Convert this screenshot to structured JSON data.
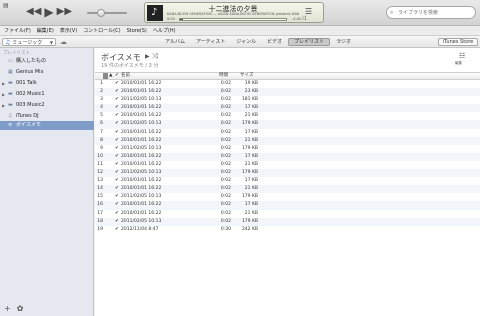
{
  "player": {
    "menu_icon": "▤",
    "rewind": "◀◀",
    "play": "▶",
    "forward": "▶▶",
    "volume_level": 0.3,
    "art_icon": "♪",
    "now_playing_title": "十二進法の夕景",
    "now_playing_sub": "KANA-BOON GENERATION — ASIAN KANA-BOON GENERATION presents NANO-MUGEN",
    "elapsed": "0:00",
    "remaining": "-4:40",
    "progress": 0.03,
    "shuffle_icon": "⤨",
    "list_icon": "☰"
  },
  "search": {
    "placeholder": "ライブラリを検索",
    "icon": "⌕"
  },
  "menubar": [
    "ファイル(F)",
    "編集(E)",
    "表示(V)",
    "コントロール(C)",
    "Store(S)",
    "ヘルプ(H)"
  ],
  "navbar": {
    "library_label": "ミュージック",
    "tabs": [
      "アルバム",
      "アーティスト",
      "ジャンル",
      "ビデオ",
      "プレイリスト",
      "ラジオ"
    ],
    "active_tab": "プレイリスト",
    "store_label": "iTunes Store"
  },
  "sidebar": {
    "header": "プレイリスト",
    "items": [
      {
        "label": "購入したもの",
        "icon": "▭"
      },
      {
        "label": "Genius Mix",
        "icon": "▦"
      },
      {
        "label": "001 Talk",
        "icon": "▬"
      },
      {
        "label": "002 Music1",
        "icon": "▬"
      },
      {
        "label": "003 Music2",
        "icon": "▬"
      },
      {
        "label": "iTunes DJ",
        "icon": "♫"
      },
      {
        "label": "ボイスメモ",
        "icon": "≡"
      }
    ],
    "add_icon": "+",
    "settings_icon": "✿"
  },
  "playlist": {
    "title": "ボイスメモ",
    "meta": "19 件のボイスメモ / 3 分",
    "edit_label": "編集",
    "columns": {
      "name": "名前",
      "time": "時間",
      "size": "サイズ"
    },
    "rows": [
      {
        "n": "1",
        "name": "2010/01/01 16:22",
        "time": "0:02",
        "size": "19 KB"
      },
      {
        "n": "2",
        "name": "2010/01/01 16:22",
        "time": "0:02",
        "size": "23 KB"
      },
      {
        "n": "3",
        "name": "2011/02/05 10:13",
        "time": "0:02",
        "size": "181 KB"
      },
      {
        "n": "4",
        "name": "2010/01/01 16:22",
        "time": "0:02",
        "size": "17 KB"
      },
      {
        "n": "5",
        "name": "2010/01/01 16:22",
        "time": "0:02",
        "size": "21 KB"
      },
      {
        "n": "6",
        "name": "2011/02/05 10:13",
        "time": "0:02",
        "size": "179 KB"
      },
      {
        "n": "7",
        "name": "2010/01/01 16:22",
        "time": "0:02",
        "size": "17 KB"
      },
      {
        "n": "8",
        "name": "2010/01/01 16:22",
        "time": "0:02",
        "size": "21 KB"
      },
      {
        "n": "9",
        "name": "2011/02/05 10:13",
        "time": "0:02",
        "size": "179 KB"
      },
      {
        "n": "10",
        "name": "2010/01/01 16:22",
        "time": "0:02",
        "size": "17 KB"
      },
      {
        "n": "11",
        "name": "2010/01/01 16:22",
        "time": "0:02",
        "size": "21 KB"
      },
      {
        "n": "12",
        "name": "2011/02/05 10:13",
        "time": "0:02",
        "size": "179 KB"
      },
      {
        "n": "13",
        "name": "2010/01/01 16:22",
        "time": "0:02",
        "size": "17 KB"
      },
      {
        "n": "14",
        "name": "2010/01/01 16:22",
        "time": "0:02",
        "size": "21 KB"
      },
      {
        "n": "15",
        "name": "2011/02/05 10:13",
        "time": "0:02",
        "size": "179 KB"
      },
      {
        "n": "16",
        "name": "2010/01/01 16:22",
        "time": "0:02",
        "size": "17 KB"
      },
      {
        "n": "17",
        "name": "2010/01/01 16:22",
        "time": "0:02",
        "size": "21 KB"
      },
      {
        "n": "18",
        "name": "2011/02/05 10:13",
        "time": "0:02",
        "size": "179 KB"
      },
      {
        "n": "19",
        "name": "2012/11/04 8:47",
        "time": "0:30",
        "size": "242 KB"
      }
    ]
  }
}
